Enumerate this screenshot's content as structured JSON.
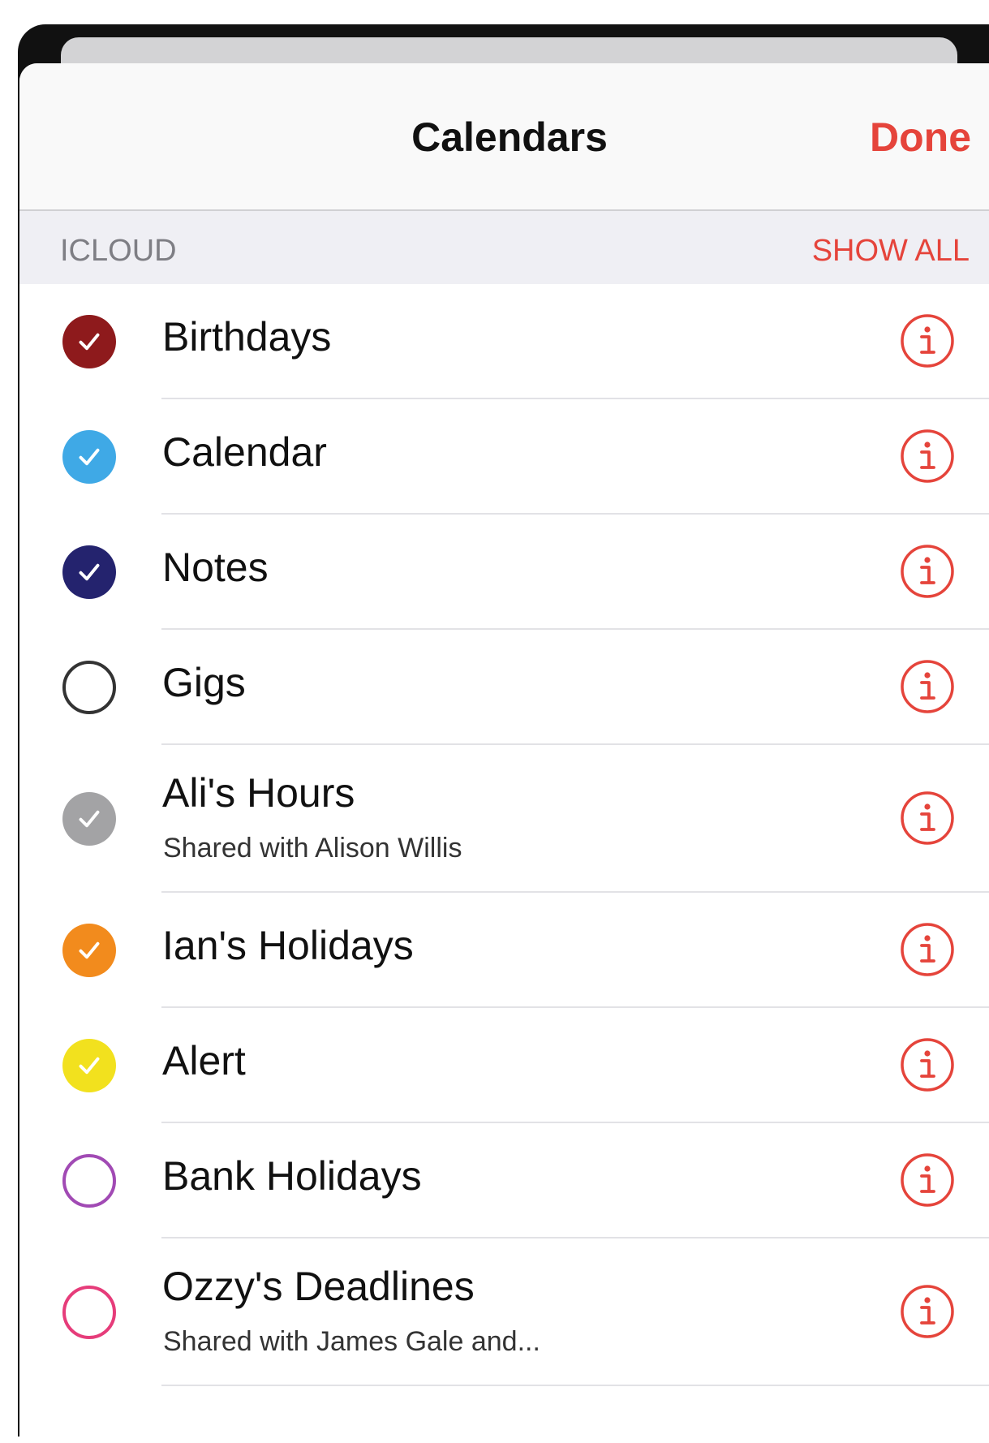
{
  "navbar": {
    "title": "Calendars",
    "done_label": "Done"
  },
  "section": {
    "title": "ICLOUD",
    "show_all_label": "SHOW ALL"
  },
  "colors": {
    "accent": "#e5443b"
  },
  "calendars": [
    {
      "name": "Birthdays",
      "checked": true,
      "color": "#8e1a1c"
    },
    {
      "name": "Calendar",
      "checked": true,
      "color": "#3fa9e6"
    },
    {
      "name": "Notes",
      "checked": true,
      "color": "#24236e"
    },
    {
      "name": "Gigs",
      "checked": false,
      "color": "#333333"
    },
    {
      "name": "Ali's Hours",
      "subtitle": "Shared with Alison Willis",
      "checked": true,
      "color": "#a3a3a5"
    },
    {
      "name": "Ian's Holidays",
      "checked": true,
      "color": "#f28b1d"
    },
    {
      "name": "Alert",
      "checked": true,
      "color": "#f2e11e"
    },
    {
      "name": "Bank Holidays",
      "checked": false,
      "color": "#a14ab4"
    },
    {
      "name": "Ozzy's Deadlines",
      "subtitle": "Shared with James Gale and...",
      "checked": false,
      "color": "#e63c7a"
    }
  ],
  "icons": {
    "check": "checkmark-icon",
    "info": "info-icon"
  }
}
